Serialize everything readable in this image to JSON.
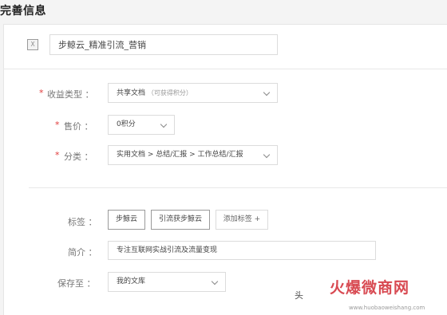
{
  "page": {
    "title": "完善信息"
  },
  "document": {
    "title_value": "步鲸云_精准引流_营销"
  },
  "form": {
    "required_mark": "*",
    "revenue_type": {
      "label": "收益类型 ：",
      "value": "共享文档",
      "hint": "（可获得积分）"
    },
    "price": {
      "label": "售价 ：",
      "value": "0积分"
    },
    "category": {
      "label": "分类 ：",
      "value": "实用文档 > 总结/汇报 > 工作总结/汇报"
    },
    "tags": {
      "label": "标签 ：",
      "items": [
        "步鲸云",
        "引流获步鲸云"
      ],
      "add_label": "添加标签 +"
    },
    "intro": {
      "label": "简介 ：",
      "value": "专注互联网实战引流及流量变现"
    },
    "save_to": {
      "label": "保存至 ：",
      "value": "我的文库"
    }
  },
  "watermark": {
    "brand": "火爆微商网",
    "prefix": "头",
    "url": "www.huobaoweishang.com"
  },
  "colors": {
    "required": "#e03a3a",
    "watermark": "#d84a52"
  },
  "icons": {
    "file": "file-icon",
    "chevron": "chevron-down-icon",
    "plus": "plus-icon"
  }
}
